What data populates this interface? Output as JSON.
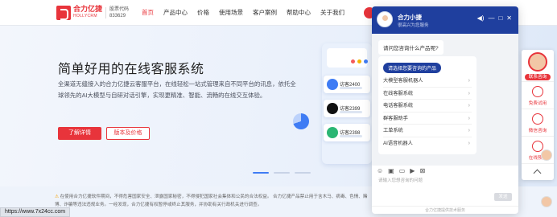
{
  "brand": {
    "name_cn": "合力亿捷",
    "name_en": "HOLLYCRM",
    "stock_label": "股票代码",
    "stock_code": "833629"
  },
  "nav": {
    "items": [
      "首页",
      "产品中心",
      "价格",
      "使用场景",
      "客户案例",
      "帮助中心",
      "关于我们"
    ],
    "active_index": 0
  },
  "hero": {
    "title": "简单好用的在线客服系统",
    "description": "全渠道无缝接入的合力亿捷云客服平台，在线轻松一站式管理来自不同平台的讯息，依托全球领先的AI大模型与自研对话引擎，实现更精准、智能、流畅的在线交互体验。",
    "primary_button": "了解详情",
    "secondary_button": "版本及价格",
    "slides": 3,
    "active_slide": 0
  },
  "illustration": {
    "cards": [
      {
        "label": "访客2400",
        "color": "#3f7cf4"
      },
      {
        "label": "访客2399",
        "color": "#111111"
      },
      {
        "label": "访客2398",
        "color": "#2bb673"
      }
    ],
    "dot_colors": [
      "#f45b5b",
      "#f4b400",
      "#3f7cf4"
    ]
  },
  "notice": {
    "text": "在使用合力亿捷软件期间，不得危害国家安全、泄露国家秘密，不得侵犯国家社会集体和公民的合法权益。 合力亿捷产品禁止用于含木马、病毒、色情、赌博、诈骗等违法违规业务。一经发现，合力亿捷有权暂停或终止其服务，并协助有关行政机关进行调查。"
  },
  "status_bar": {
    "url": "https://www.7x24cc.com"
  },
  "chat": {
    "agent_name": "合力小捷",
    "agent_status": "很高兴为您服务",
    "question": "请问您咨询什么产品呢?",
    "menu_title": "请选择您要咨询的产品",
    "menu_items": [
      "大模型客服机器人",
      "在线客服系统",
      "电话客服系统",
      "群客服助手",
      "工单系统",
      "AI语音机器人"
    ],
    "input_placeholder": "请输入您想咨询的问题",
    "send_label": "发送",
    "footer": "合力亿捷提供技术服务",
    "tool_icons": [
      "emoji-icon",
      "image-icon",
      "file-icon",
      "video-icon",
      "screenshot-icon"
    ]
  },
  "sidebar": {
    "items": [
      {
        "label": "联系咨询",
        "icon": "avatar"
      },
      {
        "label": "免费试用",
        "icon": "gift-icon"
      },
      {
        "label": "微信咨询",
        "icon": "wechat-icon"
      },
      {
        "label": "在线预览",
        "icon": "preview-icon"
      }
    ]
  },
  "colors": {
    "brand_red": "#e8343b",
    "chat_blue": "#1f3f9e",
    "accent_blue": "#3f7cf4"
  }
}
